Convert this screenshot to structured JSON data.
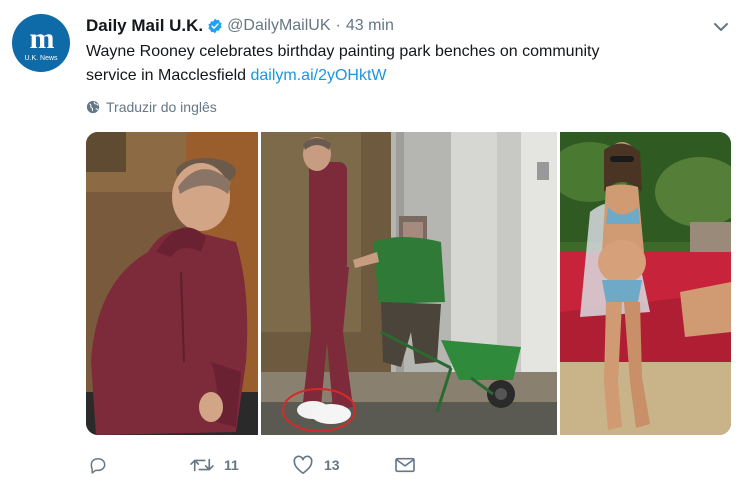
{
  "tweet": {
    "author_name": "Daily Mail U.K.",
    "avatar_text": "m",
    "avatar_subtext": "U.K. News",
    "handle": "@DailyMailUK",
    "separator": "·",
    "time": "43 min",
    "text_line1": "Wayne Rooney celebrates birthday painting park benches on community",
    "text_line2": "service in Macclesfield ",
    "link": "dailym.ai/2yOHktW",
    "translate_label": "Traduzir do inglês",
    "retweet_count": "11",
    "like_count": "13"
  },
  "icons": {
    "verified": "verified-badge-icon",
    "menu": "chevron-down-icon",
    "translate": "globe-icon",
    "reply": "reply-icon",
    "retweet": "retweet-icon",
    "like": "heart-icon",
    "message": "envelope-icon"
  },
  "colors": {
    "link": "#1b95e0",
    "muted": "#657786",
    "verified": "#1da1f2",
    "avatar_bg": "#0f6aa8"
  }
}
